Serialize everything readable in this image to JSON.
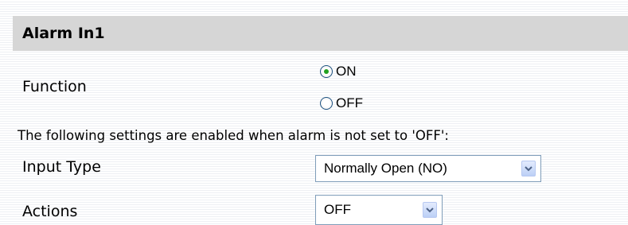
{
  "section": {
    "title": "Alarm In1"
  },
  "function": {
    "label": "Function",
    "options": [
      {
        "label": "ON",
        "checked": true
      },
      {
        "label": "OFF",
        "checked": false
      }
    ]
  },
  "note": "The following settings are enabled when alarm is not set to 'OFF':",
  "input_type": {
    "label": "Input Type",
    "selected": "Normally Open (NO)"
  },
  "actions": {
    "label": "Actions",
    "selected": "OFF"
  }
}
